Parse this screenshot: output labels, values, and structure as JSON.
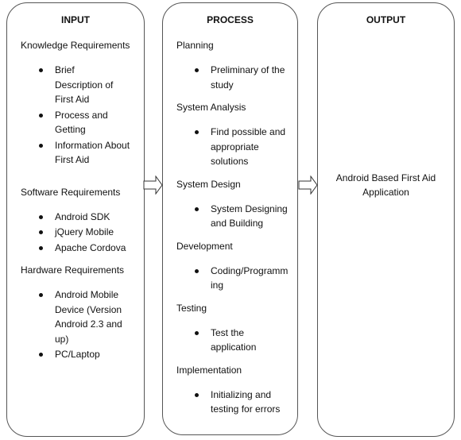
{
  "diagram": {
    "input": {
      "title": "INPUT",
      "groups": [
        {
          "heading": "Knowledge Requirements",
          "items": [
            "Brief Description of First Aid",
            "Process and Getting",
            "Information About First Aid"
          ]
        },
        {
          "heading": "Software Requirements",
          "items": [
            "Android SDK",
            "jQuery Mobile",
            "Apache Cordova"
          ]
        },
        {
          "heading": "Hardware Requirements",
          "items": [
            "Android Mobile Device (Version Android 2.3 and up)",
            "PC/Laptop"
          ]
        }
      ]
    },
    "process": {
      "title": "PROCESS",
      "groups": [
        {
          "heading": "Planning",
          "items": [
            "Preliminary of the study"
          ]
        },
        {
          "heading": "System Analysis",
          "items": [
            "Find possible and appropriate solutions"
          ]
        },
        {
          "heading": "System Design",
          "items": [
            "System Designing and Building"
          ]
        },
        {
          "heading": "Development",
          "items": [
            "Coding/Programming"
          ]
        },
        {
          "heading": "Testing",
          "items": [
            "Test the application"
          ]
        },
        {
          "heading": "Implementation",
          "items": [
            "Initializing and testing for errors"
          ]
        }
      ]
    },
    "output": {
      "title": "OUTPUT",
      "text": "Android Based First Aid Application"
    },
    "colors": {
      "border": "#555555",
      "text": "#111111",
      "background": "#ffffff"
    }
  }
}
